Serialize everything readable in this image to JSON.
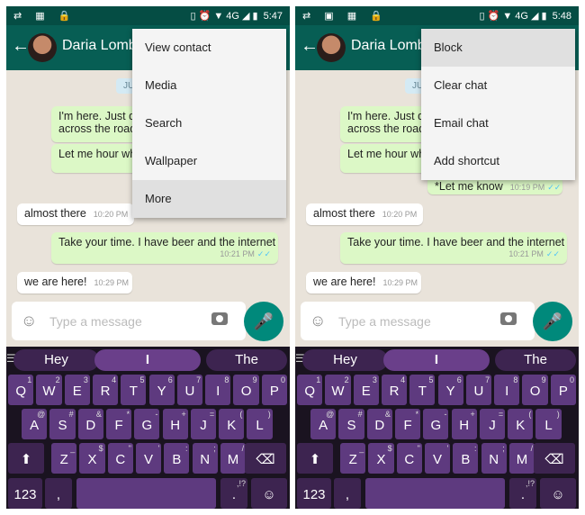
{
  "panels": [
    {
      "status": {
        "left_icons": "⇄ ▦ 🔒",
        "right_icons": "▯ ⏰ ▼ 4G ◢ ▮",
        "time": "5:47"
      },
      "header": {
        "contact_name": "Daria Lombardi"
      },
      "chat": {
        "date": "JUN",
        "messages": [
          {
            "dir": "out",
            "lines": [
              "I'm here. Just d",
              "across the road"
            ],
            "time": "",
            "ticks": ""
          },
          {
            "dir": "out",
            "lines": [
              "Let me hour wh"
            ],
            "time": "",
            "ticks": ""
          },
          {
            "dir": "in",
            "lines": [
              "almost there"
            ],
            "time": "10:20 PM",
            "ticks": ""
          },
          {
            "dir": "out",
            "lines": [
              "Take your time. I have beer and the internet"
            ],
            "time": "10:21 PM",
            "ticks": "✓✓"
          },
          {
            "dir": "in",
            "lines": [
              "we are here!"
            ],
            "time": "10:29 PM",
            "ticks": ""
          }
        ]
      },
      "menu": {
        "items": [
          "View contact",
          "Media",
          "Search",
          "Wallpaper",
          "More"
        ],
        "highlighted": 4
      }
    },
    {
      "status": {
        "left_icons": "⇄ ▣ ▦ 🔒",
        "right_icons": "▯ ⏰ ▼ 4G ◢ ▮",
        "time": "5:48"
      },
      "header": {
        "contact_name": "Daria Lombardi"
      },
      "chat": {
        "date": "JUN",
        "messages": [
          {
            "dir": "out",
            "lines": [
              "I'm here. Just dr",
              "across the road"
            ],
            "time": "",
            "ticks": ""
          },
          {
            "dir": "out",
            "lines": [
              "Let me hour whe"
            ],
            "time": "",
            "ticks": ""
          },
          {
            "dir": "out",
            "lines": [
              "*Let me know"
            ],
            "time": "10:19 PM",
            "ticks": "✓✓"
          },
          {
            "dir": "in",
            "lines": [
              "almost there"
            ],
            "time": "10:20 PM",
            "ticks": ""
          },
          {
            "dir": "out",
            "lines": [
              "Take your time. I have beer and the internet"
            ],
            "time": "10:21 PM",
            "ticks": "✓✓"
          },
          {
            "dir": "in",
            "lines": [
              "we are here!"
            ],
            "time": "10:29 PM",
            "ticks": ""
          }
        ]
      },
      "menu": {
        "items": [
          "Block",
          "Clear chat",
          "Email chat",
          "Add shortcut"
        ],
        "highlighted": 0
      }
    }
  ],
  "input": {
    "placeholder": "Type a message"
  },
  "keyboard": {
    "suggestions": [
      "Hey",
      "I",
      "The"
    ],
    "row1": [
      [
        "Q",
        "1"
      ],
      [
        "W",
        "2"
      ],
      [
        "E",
        "3"
      ],
      [
        "R",
        "4"
      ],
      [
        "T",
        "5"
      ],
      [
        "Y",
        "6"
      ],
      [
        "U",
        "7"
      ],
      [
        "I",
        "8"
      ],
      [
        "O",
        "9"
      ],
      [
        "P",
        "0"
      ]
    ],
    "row2": [
      [
        "A",
        "@"
      ],
      [
        "S",
        "#"
      ],
      [
        "D",
        "&"
      ],
      [
        "F",
        "*"
      ],
      [
        "G",
        "-"
      ],
      [
        "H",
        "+"
      ],
      [
        "J",
        "="
      ],
      [
        "K",
        "("
      ],
      [
        "L",
        ")"
      ]
    ],
    "row3": [
      [
        "Z",
        "_"
      ],
      [
        "X",
        "$"
      ],
      [
        "C",
        "\""
      ],
      [
        "V",
        "'"
      ],
      [
        "B",
        ":"
      ],
      [
        "N",
        ";"
      ],
      [
        "M",
        "/"
      ]
    ],
    "numbers_label": "123",
    "comma": ",",
    "period": ".",
    "period_hint": ",!?"
  },
  "colors": {
    "header": "#075e54",
    "status": "#054d44",
    "outgoing": "#dcf8c6",
    "mic": "#00897b",
    "keyboard_key": "#5e3a7f"
  }
}
